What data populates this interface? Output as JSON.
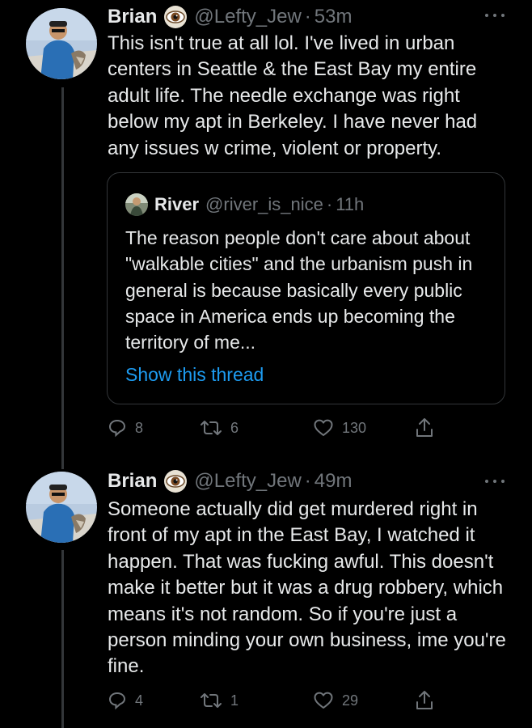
{
  "tweets": [
    {
      "author": {
        "display_name": "Brian",
        "handle": "@Lefty_Jew",
        "badge_icon": "eye-icon",
        "avatar_icon": "avatar-photo"
      },
      "separator": "·",
      "time": "53m",
      "text": "This isn't true at all lol. I've lived in urban centers in Seattle & the East Bay my entire adult life. The needle exchange was right below my apt in Berkeley. I have never had any issues w crime, violent or property.",
      "quoted_tweet": {
        "author": {
          "display_name": "River",
          "handle": "@river_is_nice",
          "avatar_icon": "avatar-photo"
        },
        "separator": "·",
        "time": "11h",
        "text": "The reason people don't care about about \"walkable cities\" and the urbanism push in general is because basically every public space in America ends up becoming the territory of me...",
        "link_label": "Show this thread"
      },
      "stats": {
        "replies": "8",
        "retweets": "6",
        "likes": "130"
      }
    },
    {
      "author": {
        "display_name": "Brian",
        "handle": "@Lefty_Jew",
        "badge_icon": "eye-icon",
        "avatar_icon": "avatar-photo"
      },
      "separator": "·",
      "time": "49m",
      "text": "Someone actually did get murdered right in front of my apt in the East Bay, I watched it happen. That was fucking awful. This doesn't make it better but it was a drug robbery, which means it's not random. So if you're just a person minding your own business, ime you're fine.",
      "stats": {
        "replies": "4",
        "retweets": "1",
        "likes": "29"
      }
    }
  ],
  "colors": {
    "background": "#000000",
    "text_primary": "#e7e9ea",
    "text_secondary": "#71767b",
    "link": "#1d9bf0",
    "border": "#333639"
  }
}
